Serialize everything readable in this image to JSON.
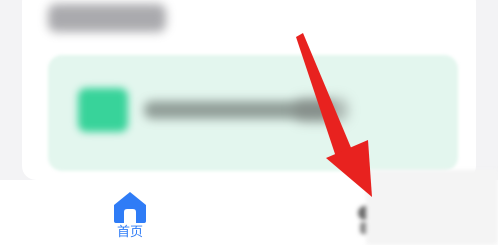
{
  "tabbar": {
    "active_color": "#2f7cf6",
    "items": [
      {
        "label": "首页",
        "icon": "home-icon",
        "active": true
      }
    ]
  },
  "annotation": {
    "arrow_color": "#e8221f"
  }
}
